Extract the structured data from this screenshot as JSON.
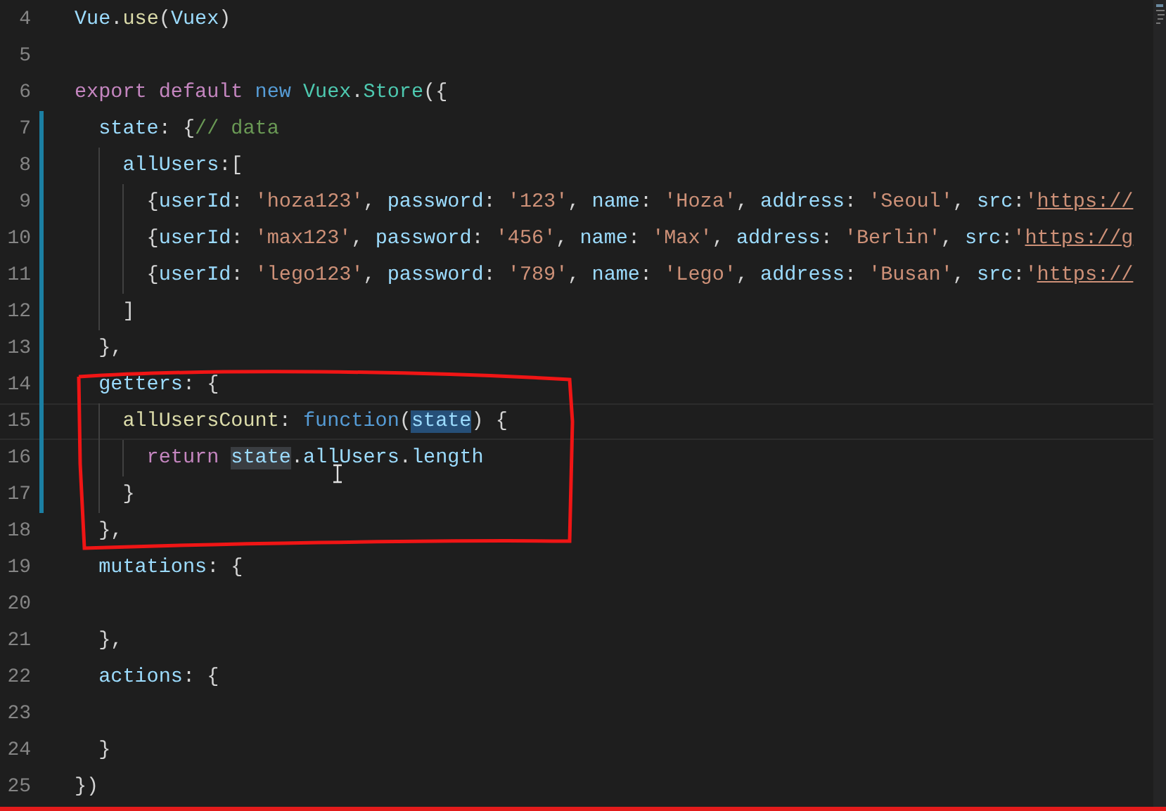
{
  "editor": {
    "lines": [
      {
        "number": "4",
        "modified": false,
        "current": false,
        "tokens": [
          {
            "text": "Vue",
            "kind": "prop"
          },
          {
            "text": ".",
            "kind": "plain"
          },
          {
            "text": "use",
            "kind": "func"
          },
          {
            "text": "(",
            "kind": "plain"
          },
          {
            "text": "Vuex",
            "kind": "prop"
          },
          {
            "text": ")",
            "kind": "plain"
          }
        ]
      },
      {
        "number": "5",
        "modified": false,
        "current": false
      },
      {
        "number": "6",
        "modified": false,
        "current": false,
        "tokens": [
          {
            "text": "export default ",
            "kind": "keyword"
          },
          {
            "text": "new ",
            "kind": "storage"
          },
          {
            "text": "Vuex",
            "kind": "class"
          },
          {
            "text": ".",
            "kind": "plain"
          },
          {
            "text": "Store",
            "kind": "class"
          },
          {
            "text": "({",
            "kind": "plain"
          }
        ]
      },
      {
        "number": "7",
        "modified": true,
        "current": false,
        "tokens": [
          {
            "text": "  state",
            "kind": "prop"
          },
          {
            "text": ": {",
            "kind": "plain"
          },
          {
            "text": "// data",
            "kind": "comment"
          }
        ]
      },
      {
        "number": "8",
        "modified": true,
        "current": false,
        "tokens": [
          {
            "text": "    allUsers",
            "kind": "prop"
          },
          {
            "text": ":[",
            "kind": "plain"
          }
        ]
      },
      {
        "number": "9",
        "modified": true,
        "current": false,
        "tokens": [
          {
            "text": "      {",
            "kind": "plain"
          },
          {
            "text": "userId",
            "kind": "prop"
          },
          {
            "text": ": ",
            "kind": "plain"
          },
          {
            "text": "'hoza123'",
            "kind": "string"
          },
          {
            "text": ", ",
            "kind": "plain"
          },
          {
            "text": "password",
            "kind": "prop"
          },
          {
            "text": ": ",
            "kind": "plain"
          },
          {
            "text": "'123'",
            "kind": "string"
          },
          {
            "text": ", ",
            "kind": "plain"
          },
          {
            "text": "name",
            "kind": "prop"
          },
          {
            "text": ": ",
            "kind": "plain"
          },
          {
            "text": "'Hoza'",
            "kind": "string"
          },
          {
            "text": ", ",
            "kind": "plain"
          },
          {
            "text": "address",
            "kind": "prop"
          },
          {
            "text": ": ",
            "kind": "plain"
          },
          {
            "text": "'Seoul'",
            "kind": "string"
          },
          {
            "text": ", ",
            "kind": "plain"
          },
          {
            "text": "src",
            "kind": "prop"
          },
          {
            "text": ":",
            "kind": "plain"
          },
          {
            "text": "'",
            "kind": "string"
          },
          {
            "text": "https://",
            "kind": "link"
          }
        ]
      },
      {
        "number": "10",
        "modified": true,
        "current": false,
        "tokens": [
          {
            "text": "      {",
            "kind": "plain"
          },
          {
            "text": "userId",
            "kind": "prop"
          },
          {
            "text": ": ",
            "kind": "plain"
          },
          {
            "text": "'max123'",
            "kind": "string"
          },
          {
            "text": ", ",
            "kind": "plain"
          },
          {
            "text": "password",
            "kind": "prop"
          },
          {
            "text": ": ",
            "kind": "plain"
          },
          {
            "text": "'456'",
            "kind": "string"
          },
          {
            "text": ", ",
            "kind": "plain"
          },
          {
            "text": "name",
            "kind": "prop"
          },
          {
            "text": ": ",
            "kind": "plain"
          },
          {
            "text": "'Max'",
            "kind": "string"
          },
          {
            "text": ", ",
            "kind": "plain"
          },
          {
            "text": "address",
            "kind": "prop"
          },
          {
            "text": ": ",
            "kind": "plain"
          },
          {
            "text": "'Berlin'",
            "kind": "string"
          },
          {
            "text": ", ",
            "kind": "plain"
          },
          {
            "text": "src",
            "kind": "prop"
          },
          {
            "text": ":",
            "kind": "plain"
          },
          {
            "text": "'",
            "kind": "string"
          },
          {
            "text": "https://g",
            "kind": "link"
          }
        ]
      },
      {
        "number": "11",
        "modified": true,
        "current": false,
        "tokens": [
          {
            "text": "      {",
            "kind": "plain"
          },
          {
            "text": "userId",
            "kind": "prop"
          },
          {
            "text": ": ",
            "kind": "plain"
          },
          {
            "text": "'lego123'",
            "kind": "string"
          },
          {
            "text": ", ",
            "kind": "plain"
          },
          {
            "text": "password",
            "kind": "prop"
          },
          {
            "text": ": ",
            "kind": "plain"
          },
          {
            "text": "'789'",
            "kind": "string"
          },
          {
            "text": ", ",
            "kind": "plain"
          },
          {
            "text": "name",
            "kind": "prop"
          },
          {
            "text": ": ",
            "kind": "plain"
          },
          {
            "text": "'Lego'",
            "kind": "string"
          },
          {
            "text": ", ",
            "kind": "plain"
          },
          {
            "text": "address",
            "kind": "prop"
          },
          {
            "text": ": ",
            "kind": "plain"
          },
          {
            "text": "'Busan'",
            "kind": "string"
          },
          {
            "text": ", ",
            "kind": "plain"
          },
          {
            "text": "src",
            "kind": "prop"
          },
          {
            "text": ":",
            "kind": "plain"
          },
          {
            "text": "'",
            "kind": "string"
          },
          {
            "text": "https://",
            "kind": "link"
          }
        ]
      },
      {
        "number": "12",
        "modified": true,
        "current": false,
        "tokens": [
          {
            "text": "    ]",
            "kind": "plain"
          }
        ]
      },
      {
        "number": "13",
        "modified": true,
        "current": false,
        "tokens": [
          {
            "text": "  },",
            "kind": "plain"
          }
        ]
      },
      {
        "number": "14",
        "modified": true,
        "current": false,
        "tokens": [
          {
            "text": "  getters",
            "kind": "prop"
          },
          {
            "text": ": {",
            "kind": "plain"
          }
        ]
      },
      {
        "number": "15",
        "modified": true,
        "current": true,
        "tokens": [
          {
            "text": "    allUsersCount",
            "kind": "func"
          },
          {
            "text": ": ",
            "kind": "plain"
          },
          {
            "text": "function",
            "kind": "storage"
          },
          {
            "text": "(",
            "kind": "plain"
          },
          {
            "text": "state",
            "kind": "prop",
            "selection": true
          },
          {
            "text": ") {",
            "kind": "plain"
          }
        ]
      },
      {
        "number": "16",
        "modified": true,
        "current": false,
        "tokens": [
          {
            "text": "      return ",
            "kind": "keyword"
          },
          {
            "text": "state",
            "kind": "prop",
            "occurrence": true
          },
          {
            "text": ".",
            "kind": "plain"
          },
          {
            "text": "allUsers",
            "kind": "prop"
          },
          {
            "text": ".",
            "kind": "plain"
          },
          {
            "text": "length",
            "kind": "prop"
          }
        ]
      },
      {
        "number": "17",
        "modified": true,
        "current": false,
        "tokens": [
          {
            "text": "    }",
            "kind": "plain"
          }
        ]
      },
      {
        "number": "18",
        "modified": false,
        "current": false,
        "tokens": [
          {
            "text": "  },",
            "kind": "plain"
          }
        ]
      },
      {
        "number": "19",
        "modified": false,
        "current": false,
        "tokens": [
          {
            "text": "  mutations",
            "kind": "prop"
          },
          {
            "text": ": {",
            "kind": "plain"
          }
        ]
      },
      {
        "number": "20",
        "modified": false,
        "current": false
      },
      {
        "number": "21",
        "modified": false,
        "current": false,
        "tokens": [
          {
            "text": "  },",
            "kind": "plain"
          }
        ]
      },
      {
        "number": "22",
        "modified": false,
        "current": false,
        "tokens": [
          {
            "text": "  actions",
            "kind": "prop"
          },
          {
            "text": ": {",
            "kind": "plain"
          }
        ]
      },
      {
        "number": "23",
        "modified": false,
        "current": false
      },
      {
        "number": "24",
        "modified": false,
        "current": false,
        "tokens": [
          {
            "text": "  }",
            "kind": "plain"
          }
        ]
      },
      {
        "number": "25",
        "modified": false,
        "current": false,
        "tokens": [
          {
            "text": "})",
            "kind": "plain"
          }
        ]
      }
    ]
  }
}
